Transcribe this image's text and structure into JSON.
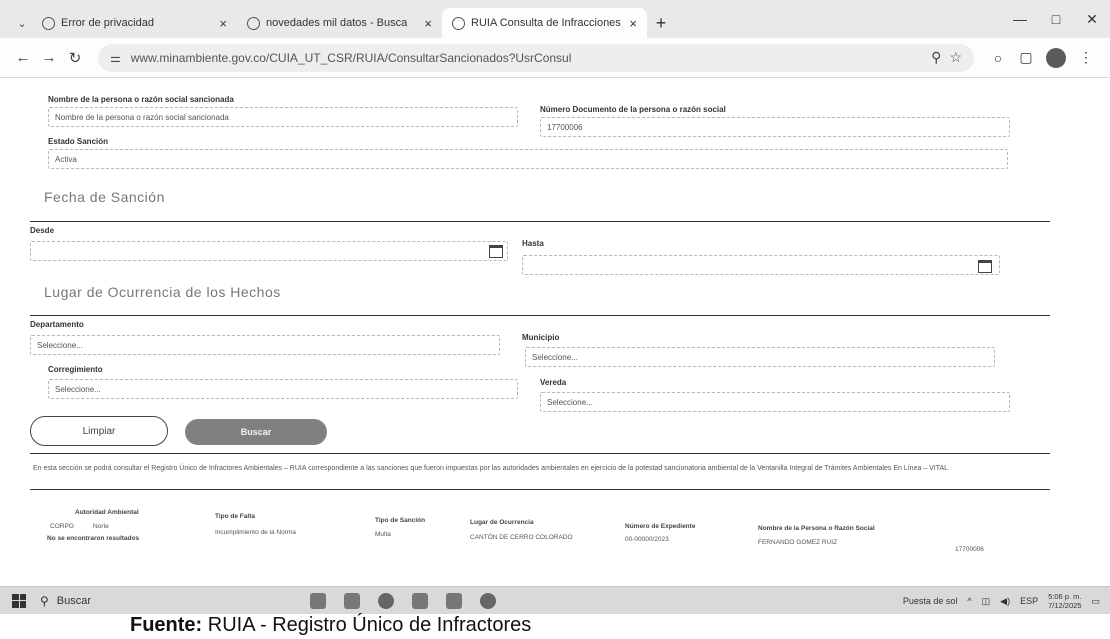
{
  "browser": {
    "tabs": [
      {
        "title": "Error de privacidad",
        "active": false
      },
      {
        "title": "novedades mil datos - Busca",
        "active": false
      },
      {
        "title": "RUIA Consulta de Infracciones",
        "active": true
      }
    ],
    "url": "www.minambiente.gov.co/CUIA_UT_CSR/RUIA/ConsultarSancionados?UsrConsul",
    "window_controls": [
      "—",
      "□",
      "✕"
    ]
  },
  "form": {
    "name_label": "Nombre de la persona o razón social sancionada",
    "name_placeholder": "Nombre de la persona o razón social sancionada",
    "doc_label": "Número Documento de la persona o razón social",
    "doc_value": "17700006",
    "status_label": "Estado Sanción",
    "status_value": "Activa",
    "section_date": "Fecha de Sanción",
    "from_label": "Desde",
    "to_label": "Hasta",
    "section_place": "Lugar de Ocurrencia de los Hechos",
    "dept_label": "Departamento",
    "dept_value": "Seleccione...",
    "muni_label": "Municipio",
    "muni_value": "Seleccione...",
    "correg_label": "Corregimiento",
    "correg_value": "Seleccione...",
    "vereda_label": "Vereda",
    "vereda_value": "Seleccione...",
    "clear_button": "Limpiar",
    "search_button": "Buscar"
  },
  "info_text": "En esta sección se podrá consultar el Registro Único de Infractores Ambientales – RUIA correspondiente a las sanciones que fueron impuestas por las autoridades ambientales en ejercicio de la potestad sancionatoria ambiental de la Ventanilla Integral de Trámites Ambientales En Línea – VITAL",
  "results": {
    "headers": [
      "Autoridad Ambiental",
      "Tipo de Falta",
      "Tipo de Sanción",
      "Lugar de Ocurrencia",
      "Número de Expediente",
      "Nombre de la Persona o Razón Social"
    ],
    "row": [
      "CORPO",
      "Norte",
      "Incumplimiento de la Norma",
      "Multa",
      "CANTÓN DE CERRO COLORADO",
      "00-00000/2023",
      "FERNANDO GOMEZ RUIZ"
    ],
    "empty_message": "No se encontraron resultados",
    "extra_cell": "17700006"
  },
  "taskbar": {
    "search_label": "Buscar",
    "weather": "Puesta de sol",
    "lang": "ESP",
    "time": "5:06 p. m.",
    "date": "7/12/2025"
  },
  "caption": {
    "bold": "Fuente:",
    "text": " RUIA - Registro Único de Infractores"
  }
}
